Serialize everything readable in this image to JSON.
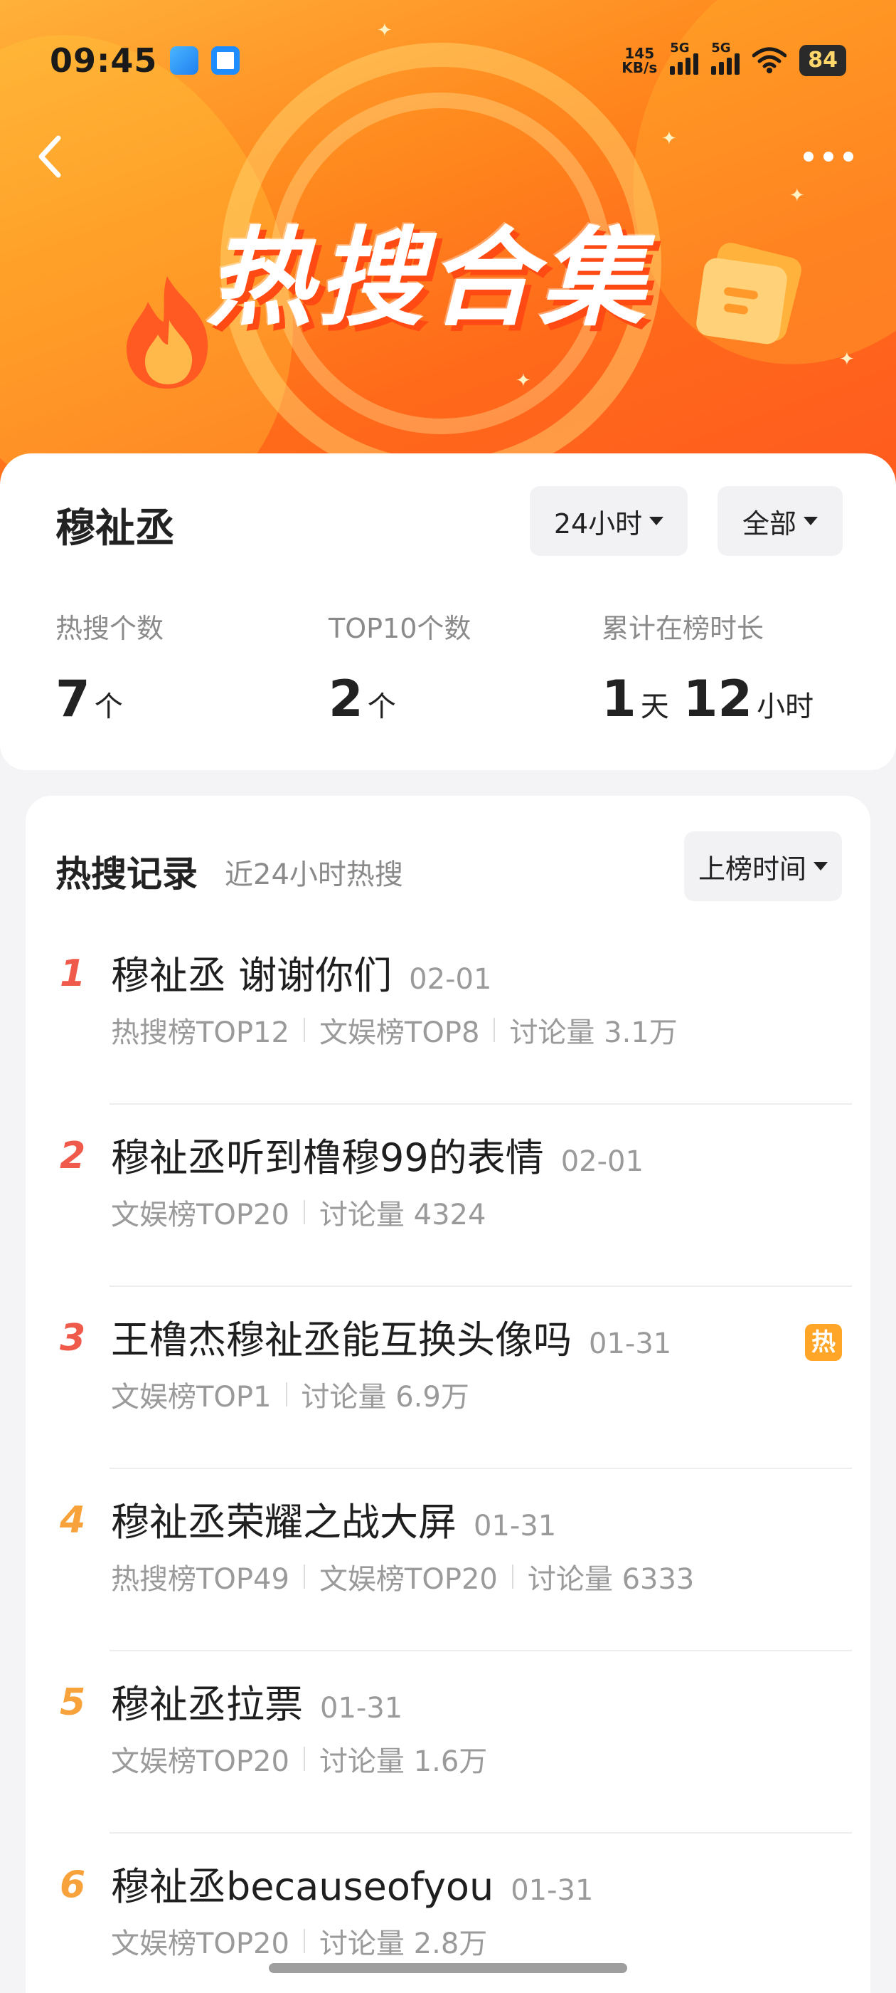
{
  "status_bar": {
    "time": "09:45",
    "net_speed_top": "145",
    "net_speed_bottom": "KB/s",
    "sim1_label": "5G",
    "sim2_label": "5G",
    "battery": "84"
  },
  "header": {
    "title_art": "热搜合集"
  },
  "summary": {
    "name": "穆祉丞",
    "range_filter": "24小时",
    "scope_filter": "全部",
    "stats": [
      {
        "label": "热搜个数",
        "value": "7",
        "unit": "个"
      },
      {
        "label": "TOP10个数",
        "value": "2",
        "unit": "个"
      },
      {
        "label": "累计在榜时长",
        "value_days": "1",
        "unit_days": "天",
        "value_hours": "12",
        "unit_hours": "小时"
      }
    ]
  },
  "records": {
    "title": "热搜记录",
    "subtitle": "近24小时热搜",
    "sort_filter": "上榜时间",
    "items": [
      {
        "rank": "1",
        "title": "穆祉丞 谢谢你们",
        "date": "02-01",
        "meta": [
          "热搜榜TOP12",
          "文娱榜TOP8",
          "讨论量 3.1万"
        ],
        "hot": ""
      },
      {
        "rank": "2",
        "title": "穆祉丞听到橹穆99的表情",
        "date": "02-01",
        "meta": [
          "文娱榜TOP20",
          "讨论量 4324"
        ],
        "hot": ""
      },
      {
        "rank": "3",
        "title": "王橹杰穆祉丞能互换头像吗",
        "date": "01-31",
        "meta": [
          "文娱榜TOP1",
          "讨论量 6.9万"
        ],
        "hot": "热"
      },
      {
        "rank": "4",
        "title": "穆祉丞荣耀之战大屏",
        "date": "01-31",
        "meta": [
          "热搜榜TOP49",
          "文娱榜TOP20",
          "讨论量 6333"
        ],
        "hot": ""
      },
      {
        "rank": "5",
        "title": "穆祉丞拉票",
        "date": "01-31",
        "meta": [
          "文娱榜TOP20",
          "讨论量 1.6万"
        ],
        "hot": ""
      },
      {
        "rank": "6",
        "title": "穆祉丞becauseofyou",
        "date": "01-31",
        "meta": [
          "文娱榜TOP20",
          "讨论量 2.8万"
        ],
        "hot": ""
      }
    ]
  },
  "colors": {
    "rank_top3": "#f05a4b",
    "rank_rest": "#f7a23a",
    "hot_badge": "#ffa629",
    "banner_primary": "#ff7a1e"
  }
}
